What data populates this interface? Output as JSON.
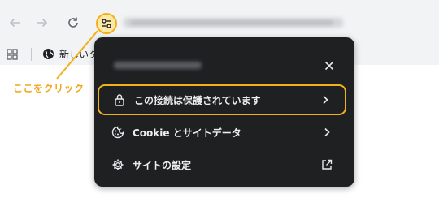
{
  "toolbar": {
    "back_icon": "back-arrow-icon",
    "forward_icon": "forward-arrow-icon",
    "reload_icon": "reload-icon",
    "site_info_icon": "tune-icon"
  },
  "bookmarks": {
    "apps_icon": "apps-grid-icon",
    "item_label": "新しいタ"
  },
  "annotation": {
    "text": "ここをクリック",
    "color": "#f2a81a"
  },
  "popup": {
    "close_icon": "close-icon",
    "items": [
      {
        "label": "この接続は保護されています",
        "icon": "lock-icon",
        "end_icon": "chevron-right-icon",
        "highlighted": true
      },
      {
        "label": "Cookie とサイトデータ",
        "icon": "cookie-icon",
        "end_icon": "chevron-right-icon"
      },
      {
        "label": "サイトの設定",
        "icon": "gear-icon",
        "end_icon": "open-in-new-icon"
      }
    ]
  },
  "colors": {
    "highlight": "#f2b11b",
    "popup_bg": "#1f2022"
  }
}
